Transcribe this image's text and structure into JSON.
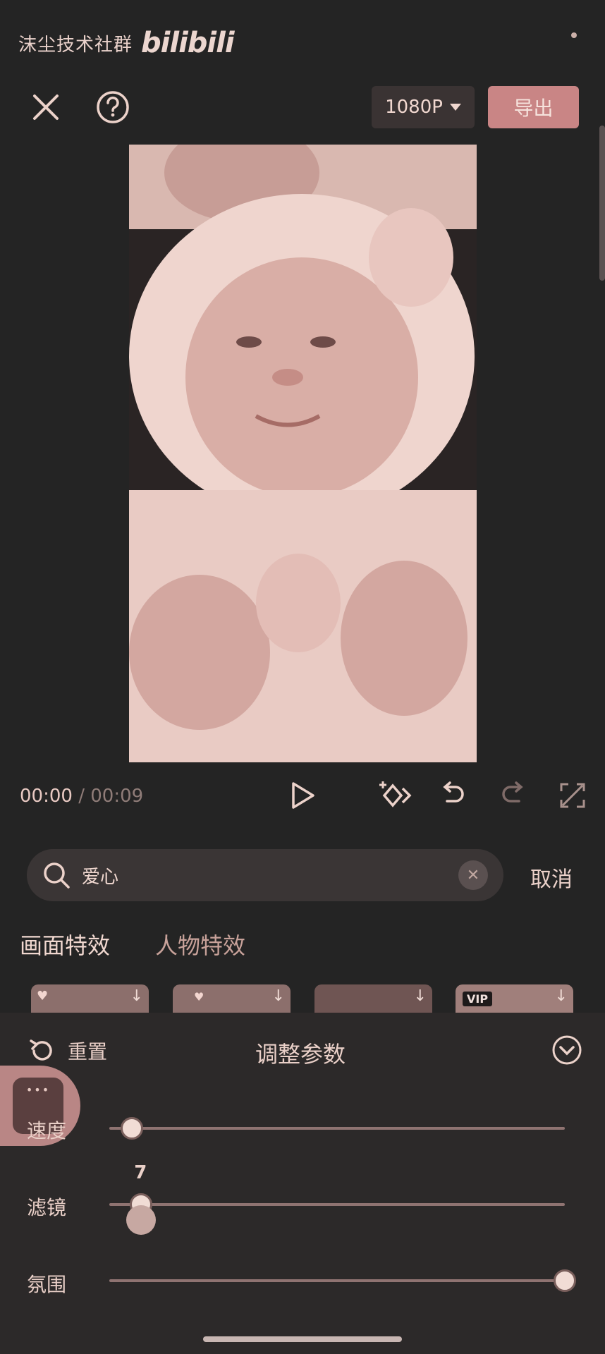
{
  "watermark": {
    "text": "沫尘技术社群",
    "logo": "bilibili"
  },
  "toolbar": {
    "resolution": "1080P",
    "export_label": "导出"
  },
  "playback": {
    "current": "00:00",
    "separator": " / ",
    "total": "00:09"
  },
  "search": {
    "query": "爱心"
  },
  "cancel_label": "取消",
  "tabs": [
    "画面特效",
    "人物特效"
  ],
  "thumb_badge": "VIP",
  "panel": {
    "reset_label": "重置",
    "title": "调整参数",
    "side_tab_icon": "•••",
    "sliders": [
      {
        "label": "速度",
        "value": 0.05
      },
      {
        "label": "滤镜",
        "value": 0.07,
        "display": "7"
      },
      {
        "label": "氛围",
        "value": 1.0
      }
    ]
  },
  "colors": {
    "accent": "#c98585",
    "background": "#242424"
  }
}
